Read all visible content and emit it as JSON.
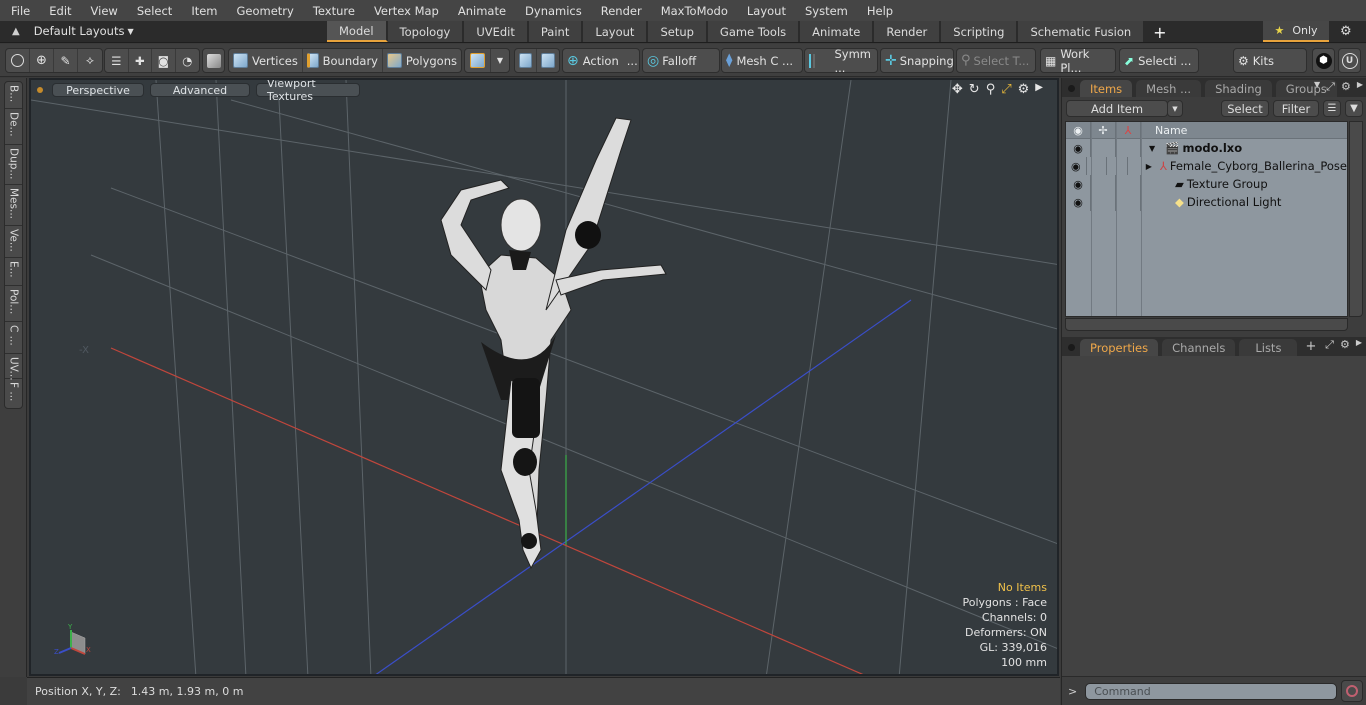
{
  "menu": [
    "File",
    "Edit",
    "View",
    "Select",
    "Item",
    "Geometry",
    "Texture",
    "Vertex Map",
    "Animate",
    "Dynamics",
    "Render",
    "MaxToModo",
    "Layout",
    "System",
    "Help"
  ],
  "layout": {
    "selector": "Default Layouts",
    "tabs": [
      "Model",
      "Topology",
      "UVEdit",
      "Paint",
      "Layout",
      "Setup",
      "Game Tools",
      "Animate",
      "Render",
      "Scripting",
      "Schematic Fusion"
    ],
    "active_tab": "Model",
    "add_tab": "+",
    "only_label": "Only"
  },
  "toolbar": {
    "vertices": "Vertices",
    "boundary": "Boundary",
    "polygons": "Polygons",
    "action": "Action",
    "action_more": "...",
    "falloff": "Falloff",
    "mesh_c": "Mesh C ...",
    "symm": "Symm ...",
    "snapping": "Snapping",
    "select_t": "Select T...",
    "work_pl": "Work Pl...",
    "selecti": "Selecti ...",
    "kits": "Kits"
  },
  "left_strip": [
    "B...",
    "De...",
    "Dup...",
    "Mes...",
    "Ve...",
    "E...",
    "Pol...",
    "C ...",
    "UV...",
    "F ..."
  ],
  "viewport": {
    "buttons": [
      "Perspective",
      "Advanced",
      "Viewport Textures"
    ],
    "stats": {
      "selection": "No Items",
      "polygons": "Polygons : Face",
      "channels": "Channels: 0",
      "deformers": "Deformers: ON",
      "gl": "GL: 339,016",
      "scale": "100 mm"
    },
    "axis_labels": {
      "x": "X",
      "y": "Y",
      "z": "Z",
      "neg_x": "-X"
    }
  },
  "status": {
    "position_label": "Position X, Y, Z:",
    "position_value": "1.43 m, 1.93 m, 0 m"
  },
  "items_panel": {
    "tabs": [
      "Items",
      "Mesh ...",
      "Shading",
      "Groups"
    ],
    "active_tab": "Items",
    "add_item": "Add Item",
    "select": "Select",
    "filter": "Filter",
    "column_name": "Name",
    "rows": [
      {
        "label": "modo.lxo",
        "bold": true
      },
      {
        "label": "Female_Cyborg_Ballerina_Pose"
      },
      {
        "label": "Texture Group"
      },
      {
        "label": "Directional Light"
      }
    ]
  },
  "properties_panel": {
    "tabs": [
      "Properties",
      "Channels",
      "Lists"
    ],
    "active_tab": "Properties",
    "add": "+"
  },
  "command": {
    "prompt": ">",
    "placeholder": "Command"
  },
  "colors": {
    "accent": "#e8a33c",
    "viewport_bg": "#343a3e",
    "x_axis": "#c0463c",
    "y_axis": "#3cb04a",
    "z_axis": "#3a4ec8",
    "stats_highlight": "#f0c14a"
  }
}
